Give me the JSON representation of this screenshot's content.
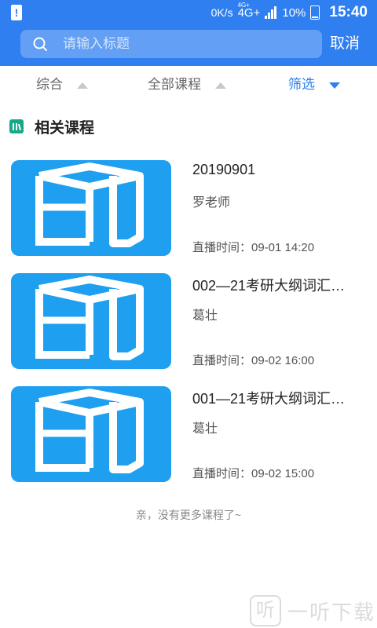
{
  "status_bar": {
    "speed": "0K/s",
    "network": "4G+",
    "network_sup": "4G+",
    "battery": "10%",
    "time": "15:40"
  },
  "search": {
    "placeholder": "请输入标题",
    "cancel_label": "取消"
  },
  "filters": [
    {
      "label": "综合",
      "active": false
    },
    {
      "label": "全部课程",
      "active": false
    },
    {
      "label": "筛选",
      "active": true
    }
  ],
  "section": {
    "title": "相关课程"
  },
  "courses": [
    {
      "title": "20190901",
      "teacher": "罗老师",
      "time": "直播时间：09-01 14:20"
    },
    {
      "title": "002—21考研大纲词汇…",
      "teacher": "葛壮",
      "time": "直播时间：09-02 16:00"
    },
    {
      "title": "001—21考研大纲词汇…",
      "teacher": "葛壮",
      "time": "直播时间：09-02 15:00"
    }
  ],
  "footer_note": "亲，没有更多课程了~",
  "watermark": {
    "logo": "听",
    "text": "一听下载"
  },
  "colors": {
    "primary": "#2f7ff0",
    "thumb": "#1e9ff0",
    "section_icon": "#17a88a"
  }
}
